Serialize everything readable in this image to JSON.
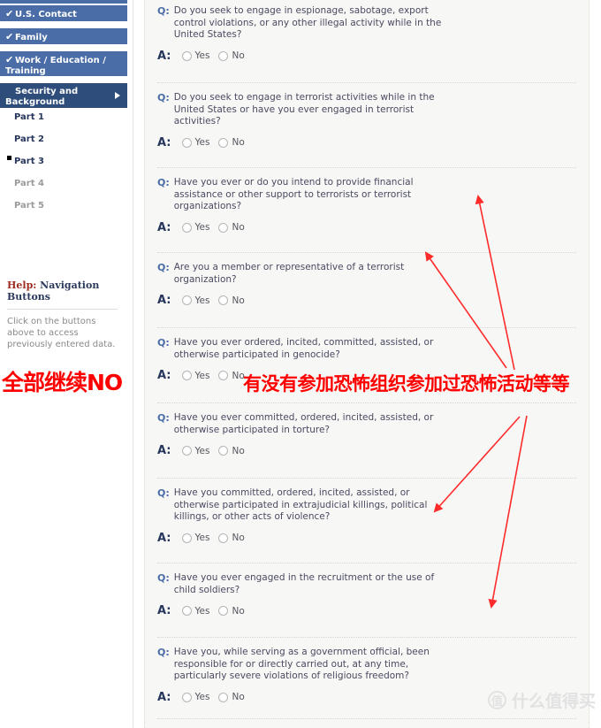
{
  "sidebar": {
    "nav_items": [
      {
        "label": "U.S. Contact",
        "check": "✔",
        "state": "complete"
      },
      {
        "label": "Family",
        "check": "✔",
        "state": "complete"
      },
      {
        "label": "Work / Education / Training",
        "check": "✔",
        "state": "complete"
      },
      {
        "label": "Security and Background",
        "check": "",
        "state": "active"
      }
    ],
    "parts": [
      {
        "label": "Part 1",
        "state": "enabled",
        "current": false
      },
      {
        "label": "Part 2",
        "state": "enabled",
        "current": false
      },
      {
        "label": "Part 3",
        "state": "enabled",
        "current": true
      },
      {
        "label": "Part 4",
        "state": "disabled",
        "current": false
      },
      {
        "label": "Part 5",
        "state": "disabled",
        "current": false
      }
    ],
    "help": {
      "title_highlight": "Help:",
      "title_rest": " Navigation Buttons",
      "body": "Click on the buttons above to access previously entered data."
    },
    "annotation": "全部继续NO"
  },
  "content": {
    "radio_options": [
      "Yes",
      "No"
    ],
    "q_mark": "Q:",
    "a_mark": "A:",
    "questions": [
      {
        "text": "Do you seek to engage in espionage, sabotage, export control violations, or any other illegal activity while in the United States?"
      },
      {
        "text": "Do you seek to engage in terrorist activities while in the United States or have you ever engaged in terrorist activities?"
      },
      {
        "text": "Have you ever or do you intend to provide financial assistance or other support to terrorists or terrorist organizations?"
      },
      {
        "text": "Are you a member or representative of a terrorist organization?"
      },
      {
        "text": "Have you ever ordered, incited, committed, assisted, or otherwise participated in genocide?"
      },
      {
        "text": "Have you ever committed, ordered, incited, assisted, or otherwise participated in torture?"
      },
      {
        "text": "Have you committed, ordered, incited, assisted, or otherwise participated in extrajudicial killings, political killings, or other acts of violence?"
      },
      {
        "text": "Have you ever engaged in the recruitment or the use of child soldiers?"
      },
      {
        "text": "Have you, while serving as a government official, been responsible for or directly carried out, at any time, particularly severe violations of religious freedom?"
      }
    ]
  },
  "annotations": {
    "chinese_note": "有没有参加恐怖组织参加过恐怖活动等等",
    "arrow_color": "#fe2b2b"
  },
  "watermark": {
    "badge": "值",
    "text": "什么值得买"
  },
  "colors": {
    "nav_blue": "#4a6da7",
    "nav_active": "#2e4d7b",
    "q_blue": "#4a6da7",
    "a_navy": "#27365c",
    "annotation_red": "#fe0000",
    "panel_bg": "#f7f7f5"
  }
}
